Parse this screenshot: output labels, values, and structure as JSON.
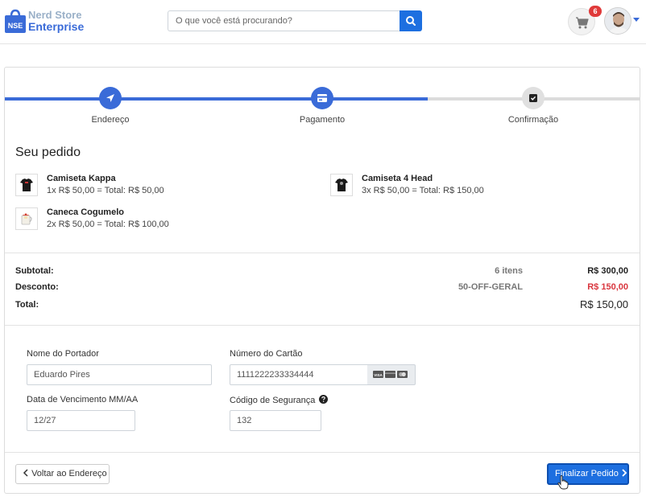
{
  "brand": {
    "line1": "Nerd Store",
    "line2": "Enterprise",
    "badge": "NSE",
    "accent_color": "#3a6bd8"
  },
  "search": {
    "placeholder": "O que você está procurando?",
    "button_icon": "search-icon"
  },
  "cart": {
    "icon": "cart-icon",
    "count": "6"
  },
  "user": {
    "avatar_icon": "avatar"
  },
  "steps": [
    {
      "label": "Endereço",
      "icon": "location-arrow-icon",
      "state": "complete"
    },
    {
      "label": "Pagamento",
      "icon": "credit-card-icon",
      "state": "active"
    },
    {
      "label": "Confirmação",
      "icon": "check-square-icon",
      "state": "pending"
    }
  ],
  "progress": {
    "completed_steps": 2,
    "total_steps": 3
  },
  "order": {
    "title": "Seu pedido",
    "items": [
      {
        "name": "Camiseta Kappa",
        "detail": "1x R$ 50,00 = Total: R$ 50,00",
        "icon": "tshirt-icon"
      },
      {
        "name": "Camiseta 4 Head",
        "detail": "3x R$ 50,00 = Total: R$ 150,00",
        "icon": "tshirt-icon"
      },
      {
        "name": "Caneca Cogumelo",
        "detail": "2x R$ 50,00 = Total: R$ 100,00",
        "icon": "mug-icon"
      }
    ]
  },
  "summary": {
    "subtotal_label": "Subtotal:",
    "subtotal_count": "6 itens",
    "subtotal_value": "R$ 300,00",
    "discount_label": "Desconto:",
    "discount_code": "50-OFF-GERAL",
    "discount_value": "R$ 150,00",
    "total_label": "Total:",
    "total_value": "R$ 150,00",
    "discount_color": "#d9363e"
  },
  "payment": {
    "holder_label": "Nome do Portador",
    "holder_value": "Eduardo Pires",
    "card_label": "Número do Cartão",
    "card_value": "1111222233334444",
    "expiry_label": "Data de Vencimento MM/AA",
    "expiry_value": "12/27",
    "cvv_label": "Código de Segurança",
    "cvv_value": "132",
    "card_brand_icons": [
      "visa-icon",
      "mastercard-icon",
      "amex-icon"
    ]
  },
  "actions": {
    "back_label": "Voltar ao Endereço",
    "finish_label": "Finalizar Pedido"
  }
}
